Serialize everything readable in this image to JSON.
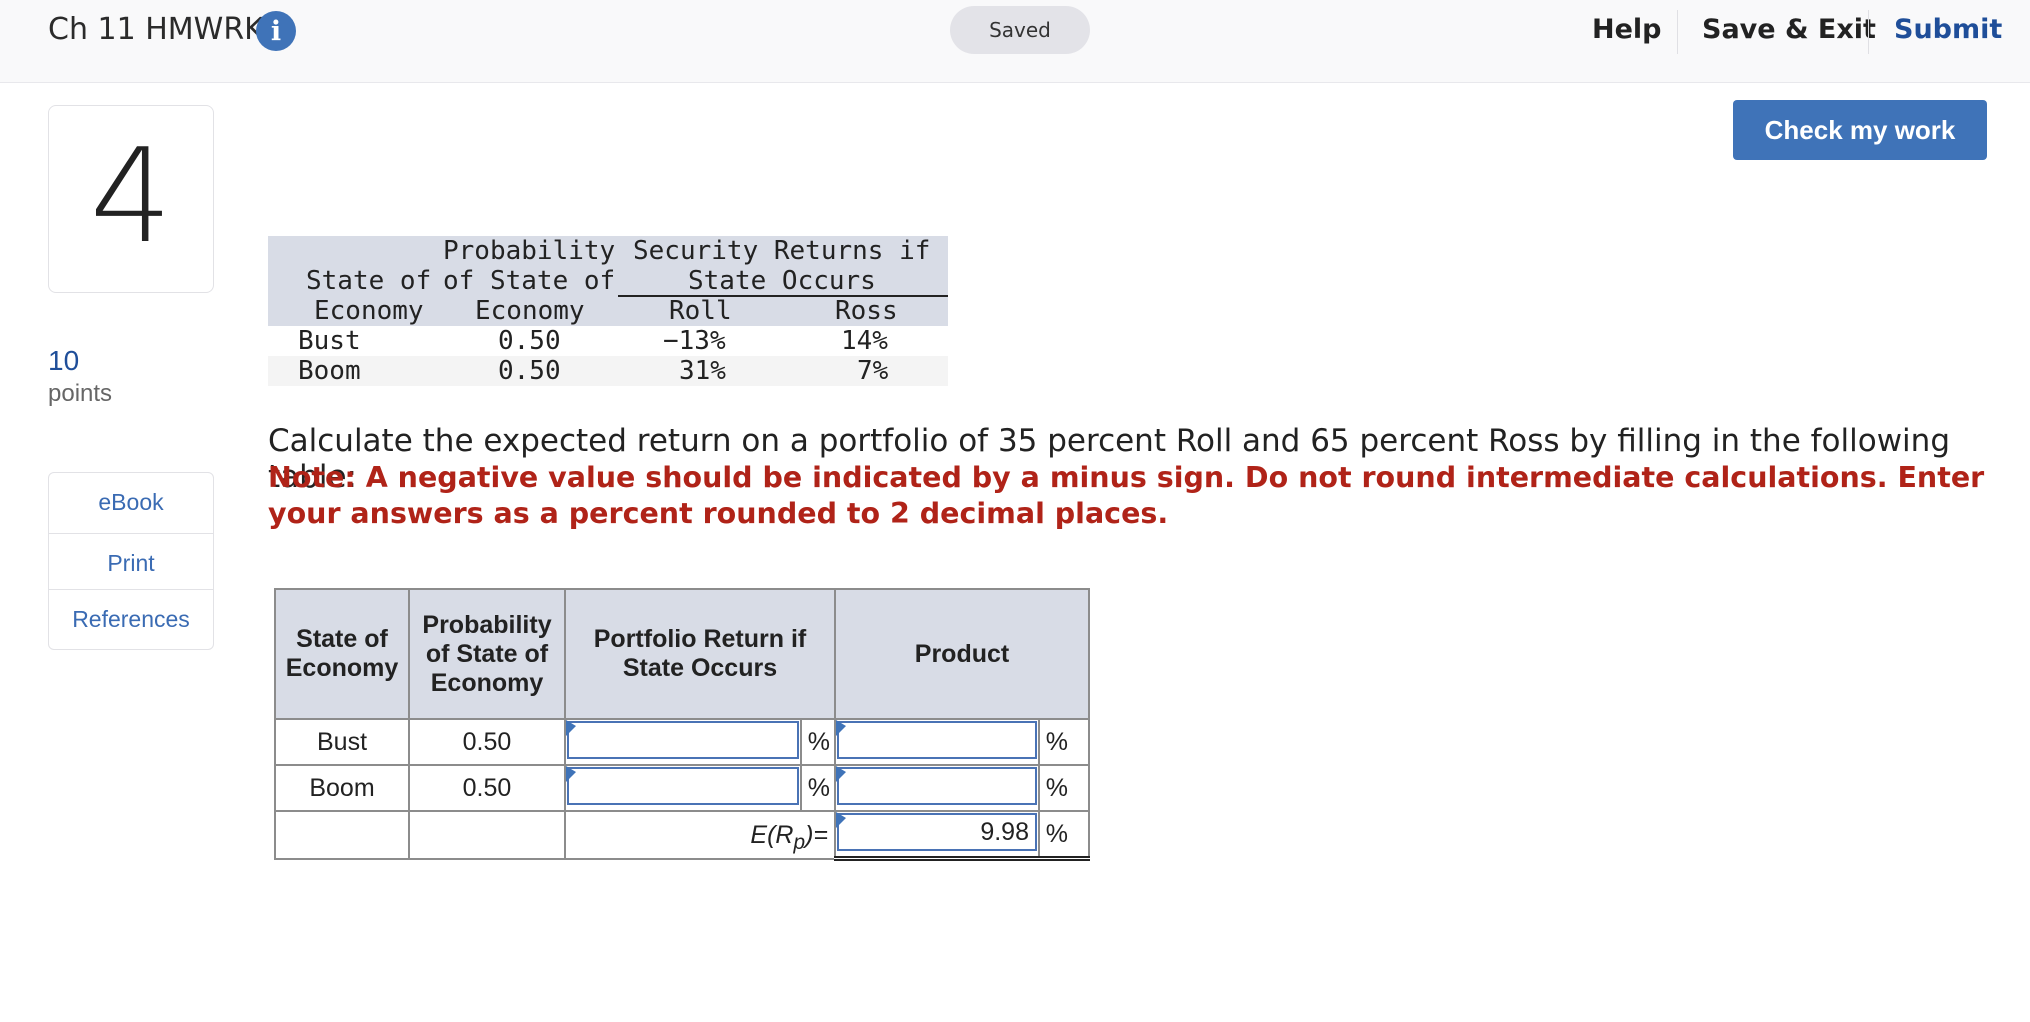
{
  "header": {
    "title": "Ch 11 HMWRK",
    "info_icon": "info-icon",
    "saved_status": "Saved",
    "help": "Help",
    "save_exit": "Save & Exit",
    "submit": "Submit"
  },
  "sidebar": {
    "question_number": "4",
    "points_value": "10",
    "points_label": "points",
    "resources": [
      "eBook",
      "Print",
      "References"
    ]
  },
  "check_button": "Check my work",
  "data_table": {
    "header_line1": {
      "prob": "Probability",
      "returns": "Security Returns if"
    },
    "header_line2": {
      "state": "State of",
      "prob": "of State of",
      "returns": "State Occurs"
    },
    "header_line3": {
      "state": "Economy",
      "prob": "Economy",
      "roll": "Roll",
      "ross": "Ross"
    },
    "rows": [
      {
        "state": "Bust",
        "prob": "0.50",
        "roll": "−13%",
        "ross": "14%"
      },
      {
        "state": "Boom",
        "prob": "0.50",
        "roll": "31%",
        "ross": "7%"
      }
    ]
  },
  "question": {
    "text": "Calculate the expected return on a portfolio of 35 percent Roll and 65 percent Ross by filling in the following table:",
    "note": "Note: A negative value should be indicated by a minus sign. Do not round intermediate calculations. Enter your answers as a percent rounded to 2 decimal places."
  },
  "answer_table": {
    "headers": {
      "state": "State of Economy",
      "prob": "Probability of State of Economy",
      "portfolio": "Portfolio Return if State Occurs",
      "product": "Product"
    },
    "rows": [
      {
        "state": "Bust",
        "prob": "0.50",
        "portfolio_value": "",
        "product_value": ""
      },
      {
        "state": "Boom",
        "prob": "0.50",
        "portfolio_value": "",
        "product_value": ""
      }
    ],
    "percent_sign": "%",
    "expected_label": "E(R",
    "expected_sub": "p",
    "expected_suffix": ")=",
    "expected_value": "9.98"
  },
  "colors": {
    "accent_blue": "#3f73b8",
    "link_blue": "#1f4e99",
    "note_red": "#b02318",
    "table_header": "#d8dce6"
  }
}
